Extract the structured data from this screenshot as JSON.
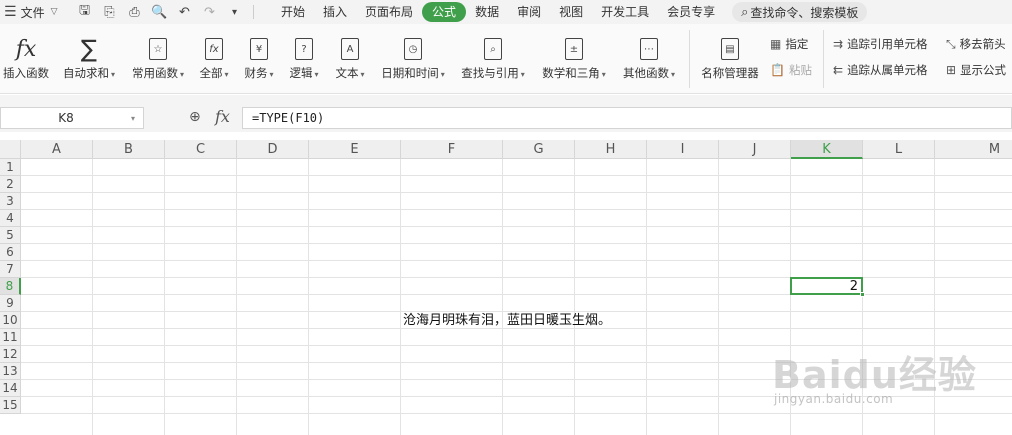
{
  "menubar": {
    "file_label": "文件",
    "tabs": [
      "开始",
      "插入",
      "页面布局",
      "公式",
      "数据",
      "审阅",
      "视图",
      "开发工具",
      "会员专享"
    ],
    "active_tab": "公式",
    "search_label": "查找命令、搜索模板"
  },
  "ribbon": {
    "buttons": [
      {
        "label": "插入函数",
        "icon": "fx-icon",
        "dropdown": false
      },
      {
        "label": "自动求和",
        "icon": "sigma-icon",
        "dropdown": true
      },
      {
        "label": "常用函数",
        "icon": "star-fx-icon",
        "dropdown": true
      },
      {
        "label": "全部",
        "icon": "fx-box-icon",
        "dropdown": true
      },
      {
        "label": "财务",
        "icon": "yen-icon",
        "dropdown": true
      },
      {
        "label": "逻辑",
        "icon": "question-box-icon",
        "dropdown": true
      },
      {
        "label": "文本",
        "icon": "text-a-icon",
        "dropdown": true
      },
      {
        "label": "日期和时间",
        "icon": "clock-icon",
        "dropdown": true
      },
      {
        "label": "查找与引用",
        "icon": "magnifier-box-icon",
        "dropdown": true
      },
      {
        "label": "数学和三角",
        "icon": "math-icon",
        "dropdown": true
      },
      {
        "label": "其他函数",
        "icon": "more-icon",
        "dropdown": true
      },
      {
        "label": "名称管理器",
        "icon": "name-manager-icon",
        "dropdown": false
      }
    ],
    "small": {
      "specify": "指定",
      "paste": "粘贴",
      "trace_precedents": "追踪引用单元格",
      "trace_dependents": "追踪从属单元格",
      "remove_arrows": "移去箭头",
      "show_formulas": "显示公式"
    }
  },
  "formula_bar": {
    "name_box": "K8",
    "fx_symbol": "fx",
    "formula": "=TYPE(F10)"
  },
  "sheet": {
    "columns": [
      "A",
      "B",
      "C",
      "D",
      "E",
      "F",
      "G",
      "H",
      "I",
      "J",
      "K",
      "L",
      "M"
    ],
    "rows": [
      "1",
      "2",
      "3",
      "4",
      "5",
      "6",
      "7",
      "8",
      "9",
      "10",
      "11",
      "12",
      "13",
      "14",
      "15"
    ],
    "selected_column": "K",
    "selected_row": "8",
    "cells": {
      "F10": "沧海月明珠有泪，蓝田日暖玉生烟。",
      "K8": "2"
    }
  },
  "watermark": {
    "main": "Baidu经验",
    "sub": "jingyan.baidu.com"
  }
}
